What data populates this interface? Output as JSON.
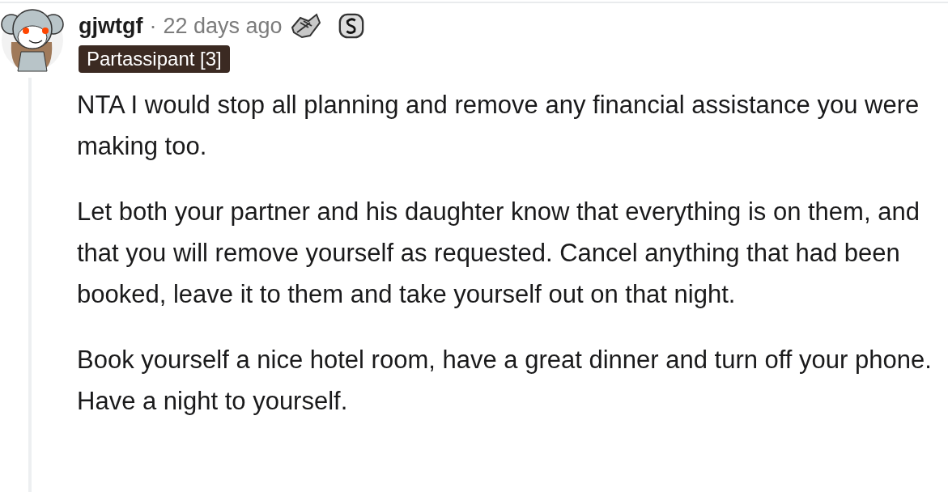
{
  "comment": {
    "author": "gjwtgf",
    "separator": "·",
    "time": "22 days ago",
    "flair": "Partassipant [3]",
    "paragraphs": [
      "NTA I would stop all planning and remove any financial assistance you were making too.",
      "Let both your partner and his daughter know that everything is on them, and that you will remove yourself as requested. Cancel anything that had been booked, leave it to them and take yourself out on that night.",
      "Book yourself a nice hotel room, have a great dinner and turn off your phone. Have a night to yourself."
    ]
  }
}
